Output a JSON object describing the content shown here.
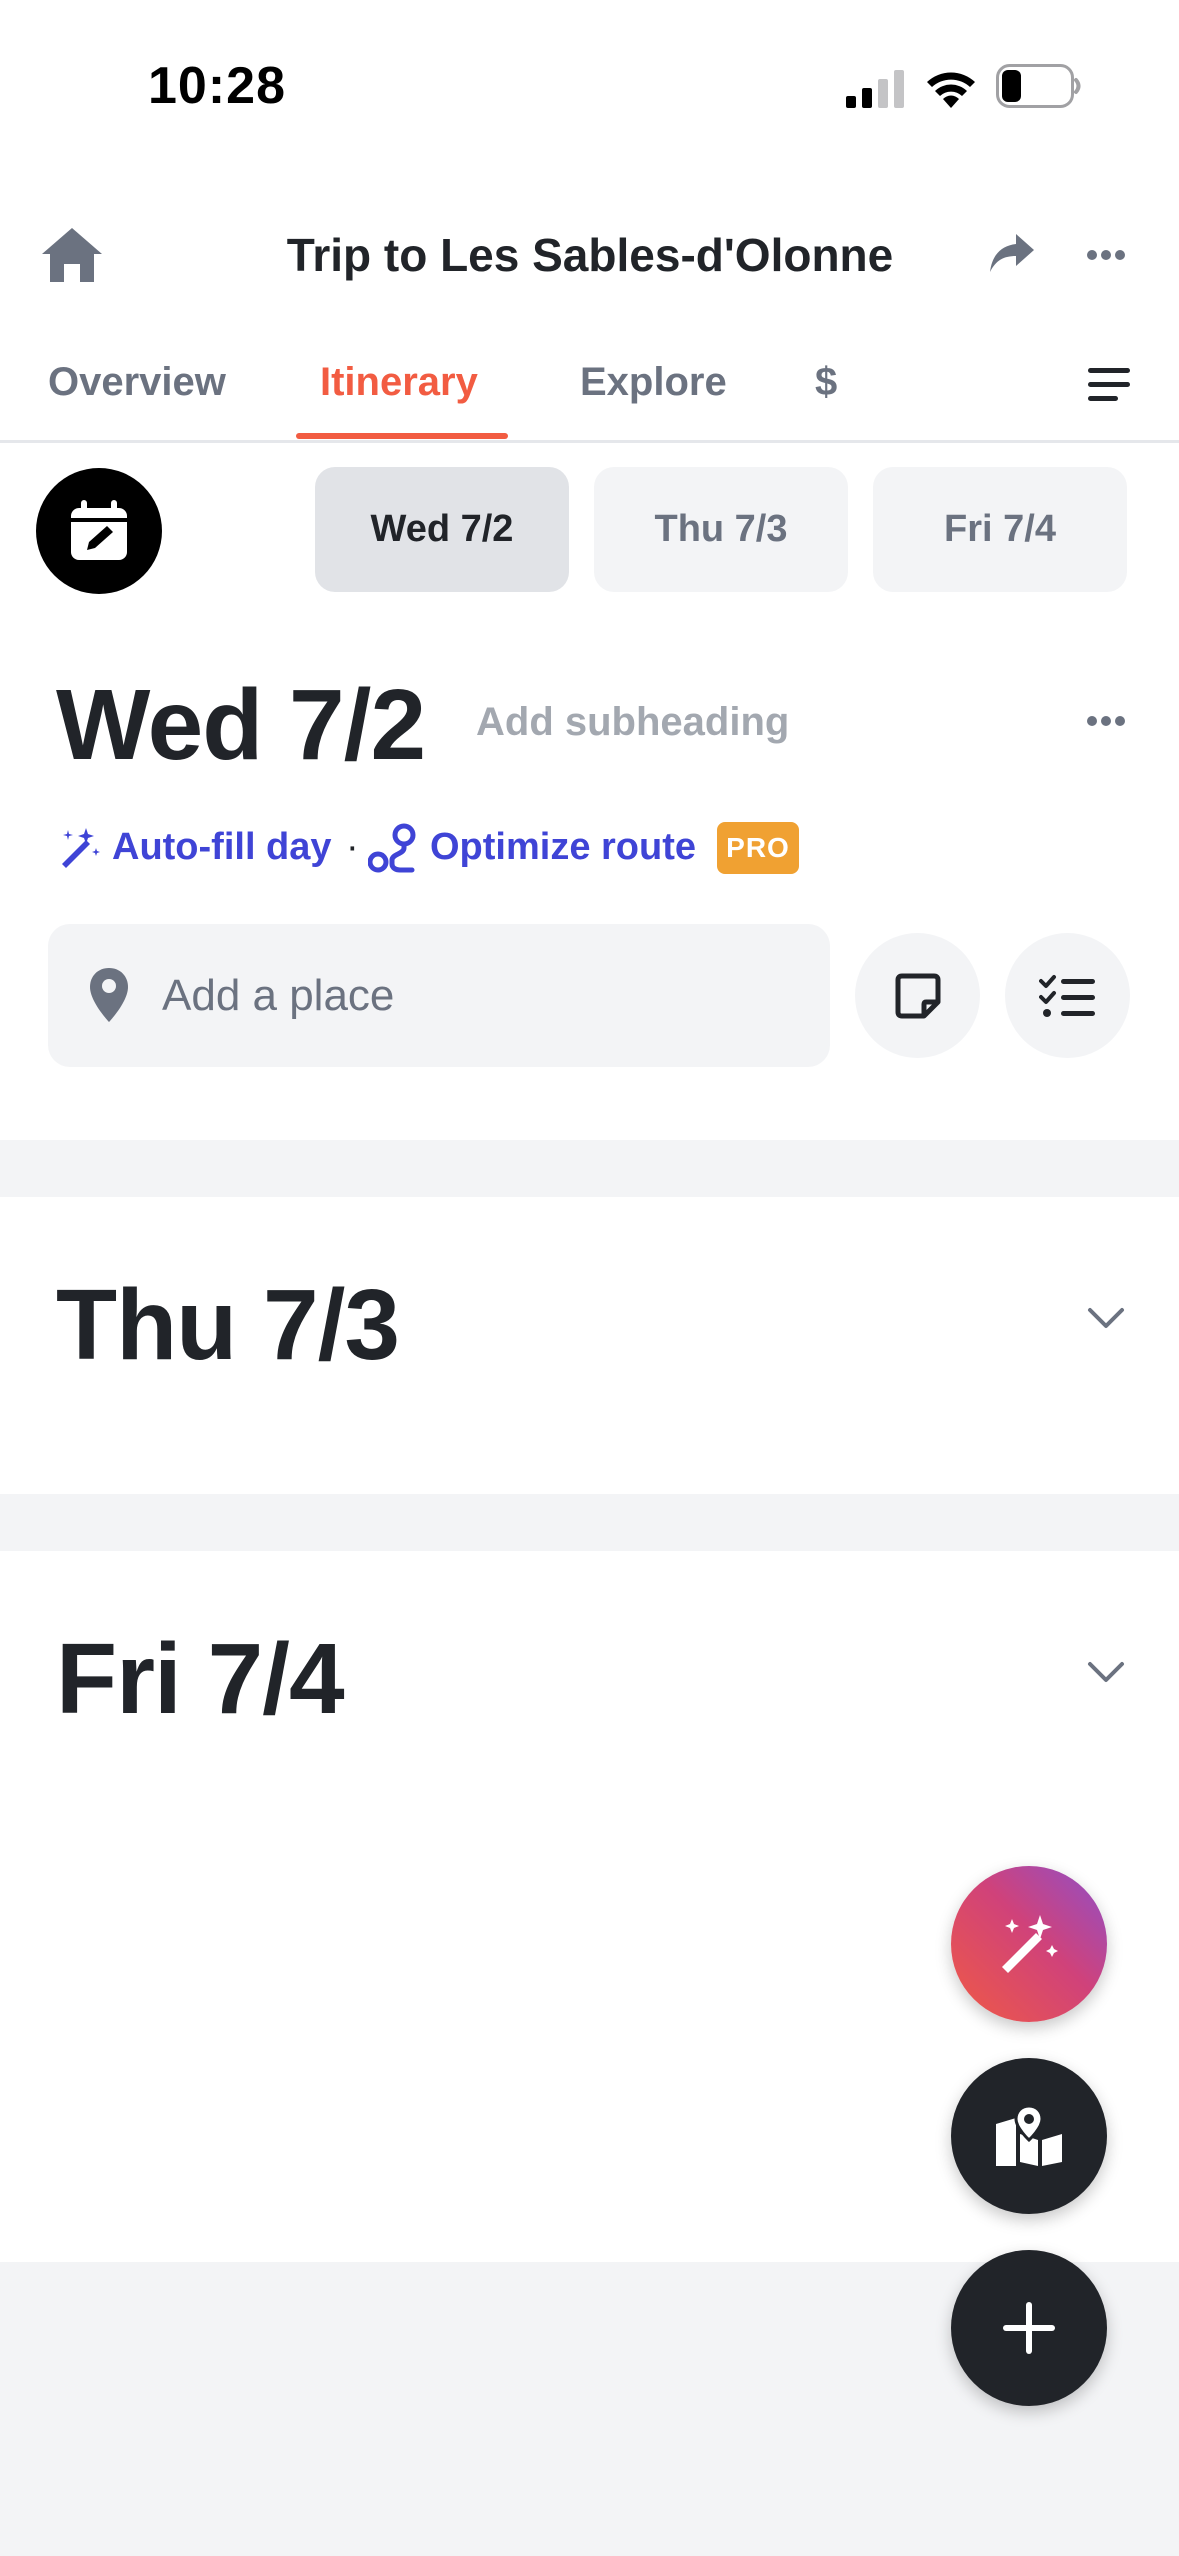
{
  "status_bar": {
    "time": "10:28",
    "battery_level": 0.25
  },
  "header": {
    "title": "Trip to Les Sables-d'Olonne"
  },
  "tabs": [
    {
      "label": "Overview",
      "active": false
    },
    {
      "label": "Itinerary",
      "active": true
    },
    {
      "label": "Explore",
      "active": false
    },
    {
      "label": "$",
      "active": false
    }
  ],
  "date_pills": [
    {
      "label": "Wed 7/2",
      "active": true
    },
    {
      "label": "Thu 7/3",
      "active": false
    },
    {
      "label": "Fri 7/4",
      "active": false
    }
  ],
  "day_wed": {
    "title": "Wed 7/2",
    "subheading_placeholder": "Add subheading",
    "autofill_label": "Auto-fill day",
    "separator": "·",
    "optimize_label": "Optimize route",
    "pro_badge": "PRO",
    "add_place_placeholder": "Add a place"
  },
  "day_thu": {
    "title": "Thu 7/3"
  },
  "day_fri": {
    "title": "Fri 7/4"
  },
  "colors": {
    "accent": "#f25c42",
    "link": "#3f44d6",
    "pro_badge": "#f0a132",
    "text": "#212429",
    "muted": "#6b7280",
    "surface": "#f3f4f6",
    "fab_dark": "#212429"
  },
  "icons": [
    "home-icon",
    "share-icon",
    "more-icon",
    "menu-icon",
    "calendar-edit-icon",
    "magic-wand-icon",
    "route-icon",
    "location-pin-icon",
    "note-icon",
    "checklist-icon",
    "chevron-down-icon",
    "map-icon",
    "plus-icon"
  ]
}
